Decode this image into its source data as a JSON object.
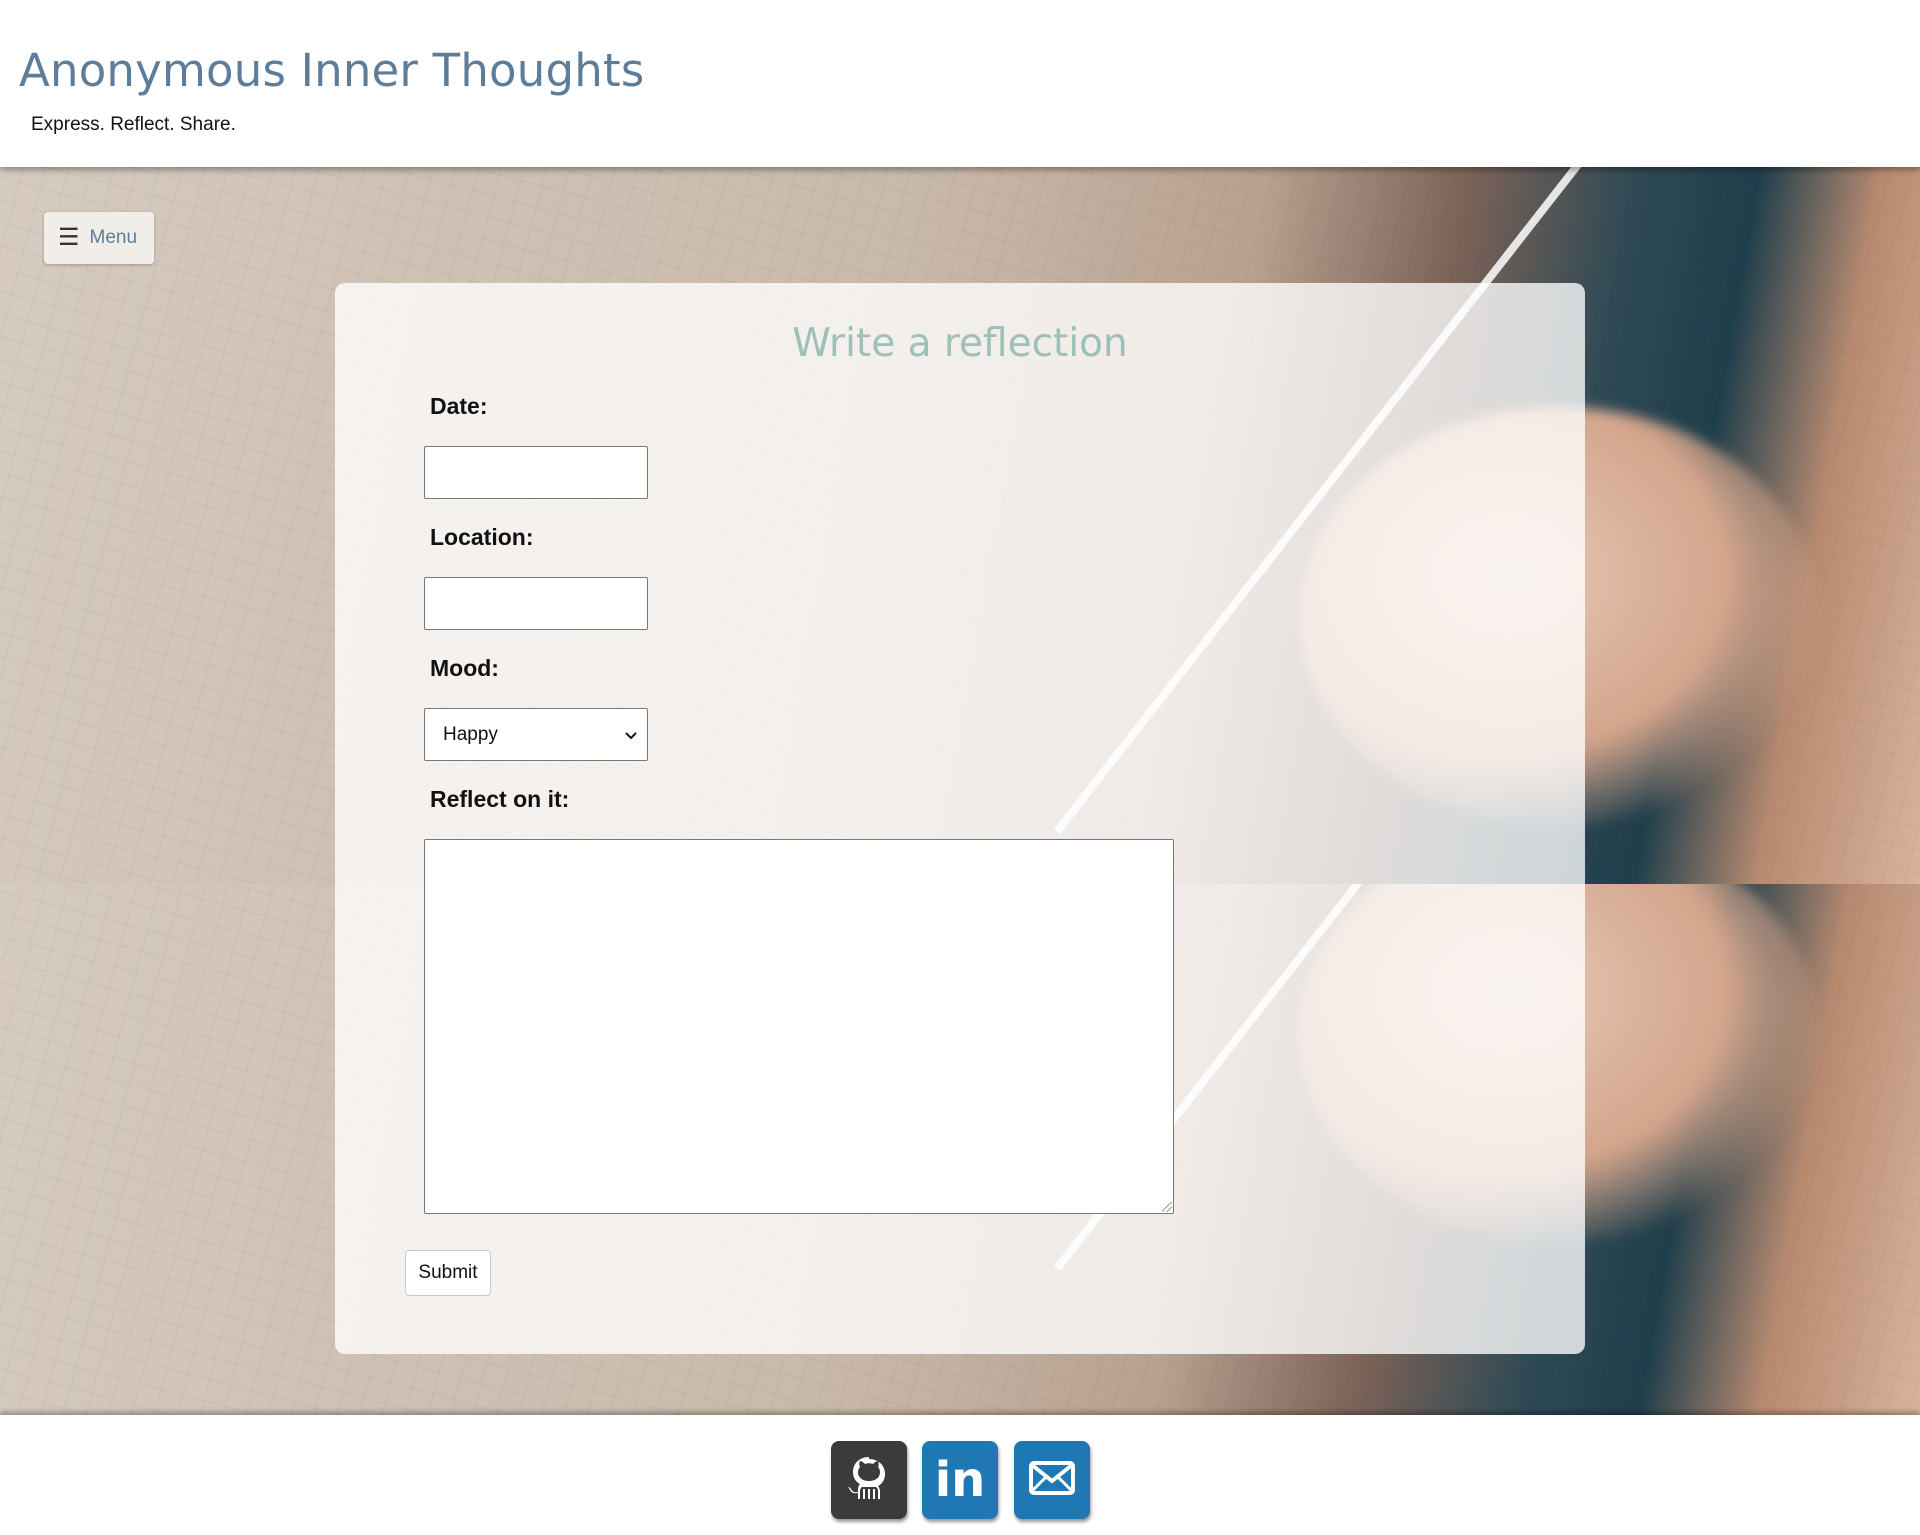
{
  "header": {
    "title": "Anonymous Inner Thoughts",
    "tagline": "Express. Reflect. Share."
  },
  "menu": {
    "label": "Menu",
    "icon": "hamburger-icon"
  },
  "form": {
    "title": "Write a reflection",
    "date_label": "Date:",
    "date_value": "",
    "location_label": "Location:",
    "location_value": "",
    "mood_label": "Mood:",
    "mood_value": "Happy",
    "reflect_label": "Reflect on it:",
    "reflect_value": "",
    "submit_label": "Submit"
  },
  "footer": {
    "links": [
      {
        "name": "github",
        "icon": "github-icon",
        "color": "#3b3b3b"
      },
      {
        "name": "linkedin",
        "icon": "linkedin-icon",
        "text": "in",
        "color": "#1f78b4"
      },
      {
        "name": "email",
        "icon": "email-icon",
        "color": "#1f78b4"
      }
    ]
  },
  "colors": {
    "title": "#5e7d99",
    "form_title": "#9ec0b8"
  }
}
